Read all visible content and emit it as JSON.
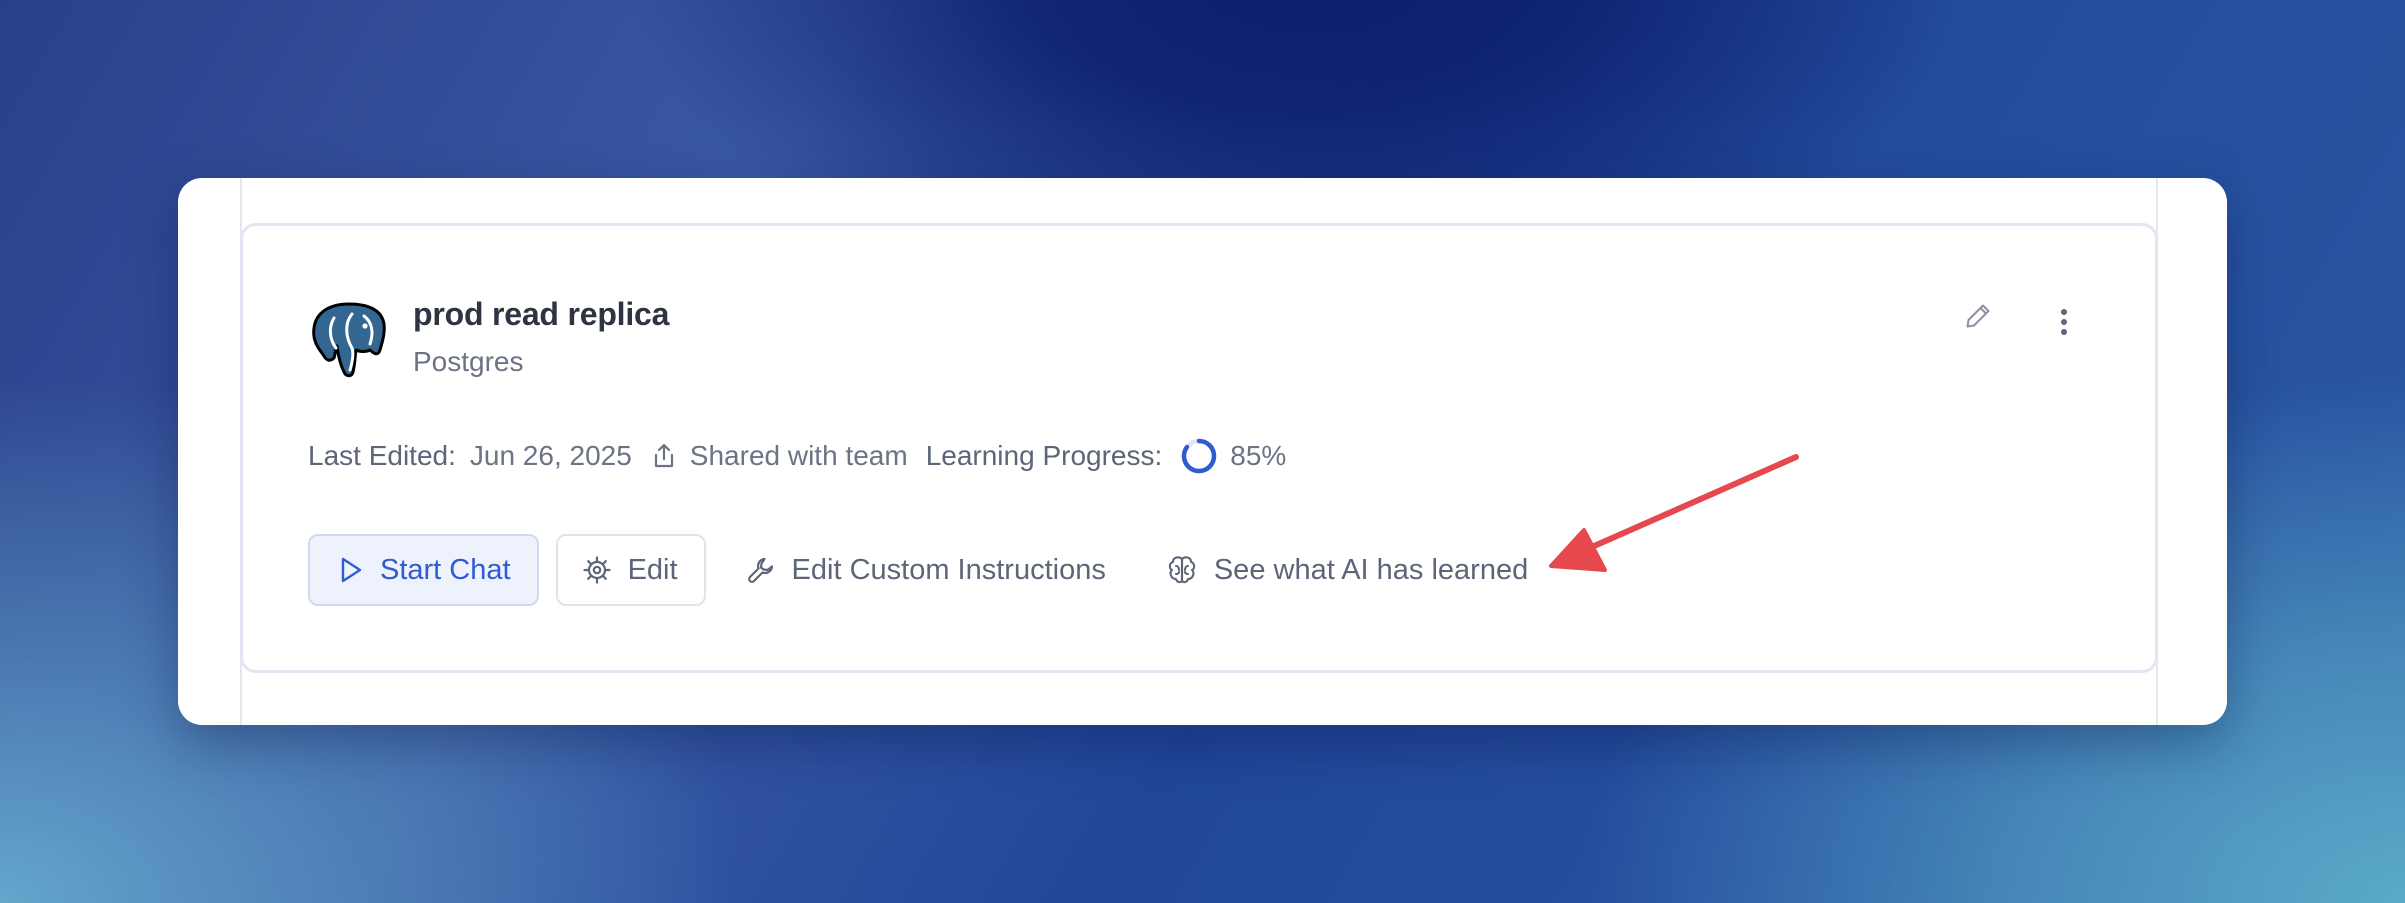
{
  "card": {
    "title": "prod read replica",
    "subtitle": "Postgres",
    "logo_icon": "postgres-elephant-logo",
    "meta": {
      "last_edited_label": "Last Edited:",
      "last_edited_value": "Jun 26, 2025",
      "shared_text": "Shared with team",
      "learning_label": "Learning Progress:",
      "learning_value": "85%",
      "learning_fraction": 0.85
    },
    "actions": {
      "start_chat": "Start Chat",
      "edit": "Edit",
      "edit_custom_instructions": "Edit Custom Instructions",
      "see_ai_learned": "See what AI has learned"
    }
  },
  "colors": {
    "accent": "#2f5bd3",
    "annotation_arrow": "#e5484d",
    "text_muted": "#6b7385",
    "title": "#2f3442"
  }
}
